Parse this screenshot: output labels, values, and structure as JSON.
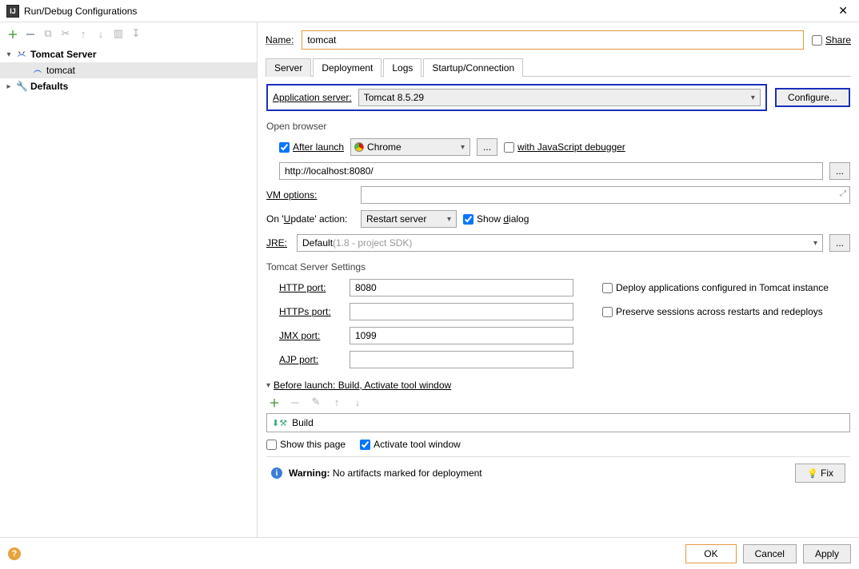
{
  "window": {
    "title": "Run/Debug Configurations"
  },
  "tree": {
    "root1": "Tomcat Server",
    "child1": "tomcat",
    "root2": "Defaults"
  },
  "form": {
    "name_label": "Name:",
    "name_value": "tomcat",
    "share_label": "Share"
  },
  "tabs": {
    "server": "Server",
    "deployment": "Deployment",
    "logs": "Logs",
    "startup": "Startup/Connection"
  },
  "server": {
    "app_server_label": "Application server:",
    "app_server_value": "Tomcat 8.5.29",
    "configure_btn": "Configure...",
    "open_browser_legend": "Open browser",
    "after_launch": "After launch",
    "browser": "Chrome",
    "ellipsis": "...",
    "with_js_debugger": "with JavaScript debugger",
    "url": "http://localhost:8080/",
    "vm_options_label": "VM options:",
    "on_update_label": "On 'Update' action:",
    "on_update_value": "Restart server",
    "show_dialog": "Show dialog",
    "jre_label": "JRE:",
    "jre_value": "Default",
    "jre_hint": " (1.8 - project SDK)",
    "tomcat_settings_legend": "Tomcat Server Settings",
    "http_port_label": "HTTP port:",
    "http_port_value": "8080",
    "https_port_label": "HTTPs port:",
    "https_port_value": "",
    "jmx_port_label": "JMX port:",
    "jmx_port_value": "1099",
    "ajp_port_label": "AJP port:",
    "ajp_port_value": "",
    "deploy_apps_label": "Deploy applications configured in Tomcat instance",
    "preserve_sessions_label": "Preserve sessions across restarts and redeploys"
  },
  "before_launch": {
    "header": "Before launch: Build, Activate tool window",
    "build_item": "Build",
    "show_this_page": "Show this page",
    "activate_tool_window": "Activate tool window"
  },
  "warning": {
    "label": "Warning:",
    "text": " No artifacts marked for deployment",
    "fix": "Fix"
  },
  "buttons": {
    "ok": "OK",
    "cancel": "Cancel",
    "apply": "Apply"
  }
}
